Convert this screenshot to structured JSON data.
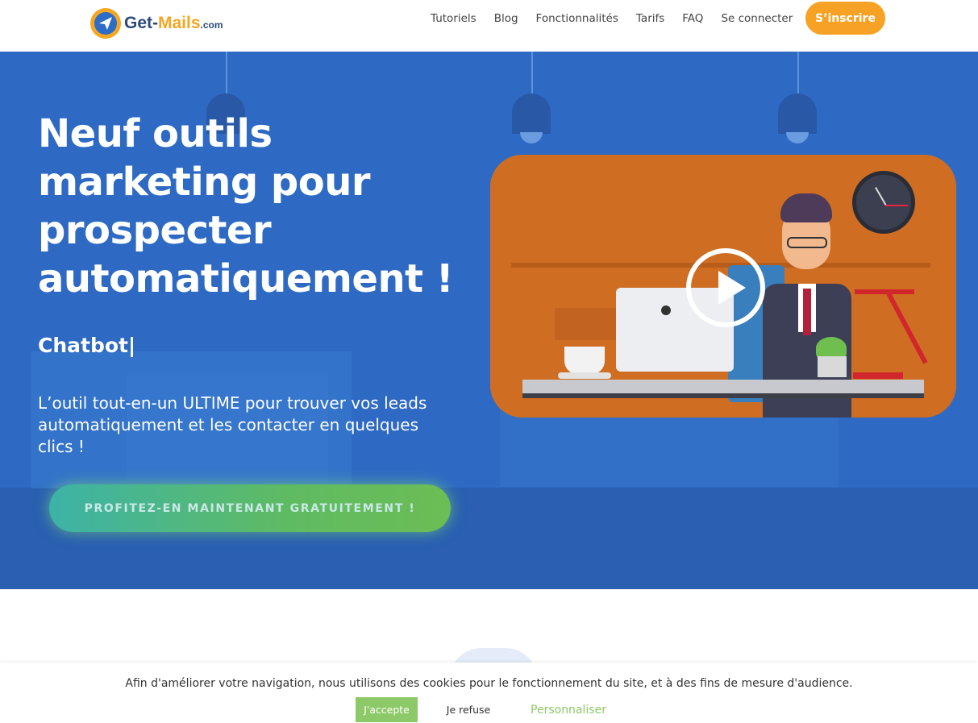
{
  "header": {
    "logo": {
      "name": "Get-",
      "accent": "Mails",
      "suffix": ".com"
    },
    "nav": [
      "Tutoriels",
      "Blog",
      "Fonctionnalités",
      "Tarifs",
      "FAQ",
      "Se connecter"
    ],
    "signup_label": "S’inscrire"
  },
  "hero": {
    "title": "Neuf outils marketing pour prospecter automatiquement !",
    "rotating_word": "Chatbot|",
    "subtitle": "L’outil tout-en-un ULTIME pour trouver vos leads automatiquement et les contacter en quelques clics !",
    "cta_label": "PROFITEZ-EN MAINTENANT GRATUITEMENT !",
    "video": {
      "play_icon": "play-icon"
    }
  },
  "cookie_bar": {
    "text": "Afin d'améliorer votre navigation, nous utilisons des cookies pour le fonctionnement du site, et à des fins de mesure d'audience.",
    "accept_label": "J'accepte",
    "refuse_label": "Je refuse",
    "customize_label": "Personnaliser"
  },
  "colors": {
    "accent_orange": "#f7a224",
    "hero_blue": "#2e6ac4",
    "cta_green": "#6cbd55",
    "cookie_green": "#8dc968"
  }
}
